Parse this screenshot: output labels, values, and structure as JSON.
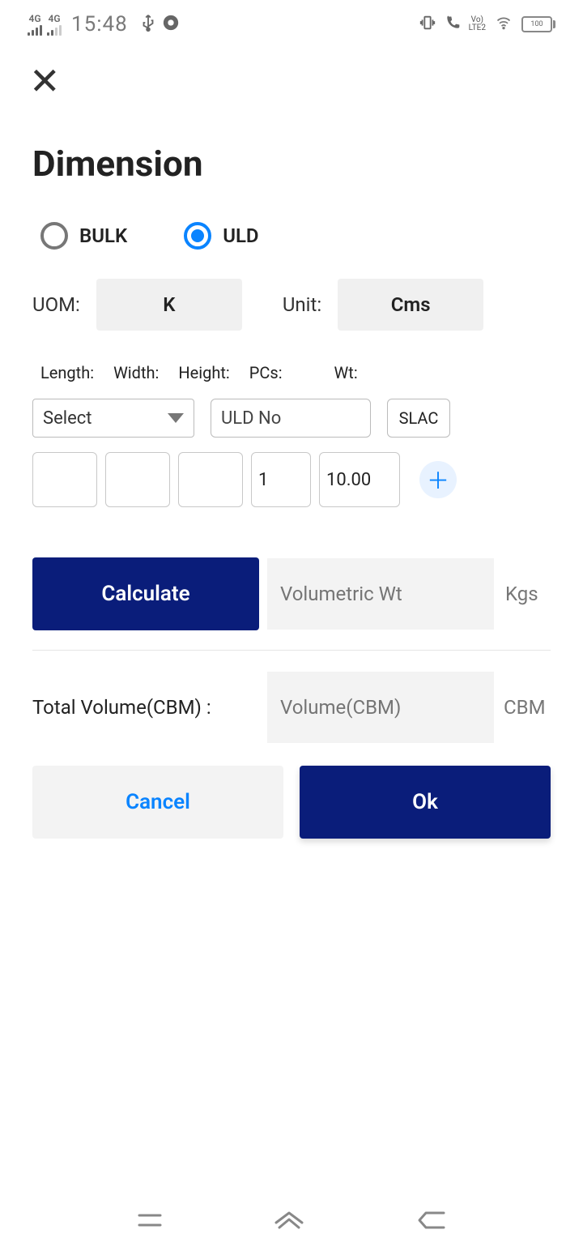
{
  "status_bar": {
    "time": "15:48",
    "battery": "100"
  },
  "close_icon": "✕",
  "title": "Dimension",
  "radios": {
    "bulk": "BULK",
    "uld": "ULD"
  },
  "uom": {
    "label": "UOM:",
    "value": "K",
    "unit_label": "Unit:",
    "unit_value": "Cms"
  },
  "headers": {
    "length": "Length:",
    "width": "Width:",
    "height": "Height:",
    "pcs": "PCs:",
    "wt": "Wt:"
  },
  "select": {
    "placeholder": "Select",
    "uldno_label": "ULD No",
    "slac": "SLAC"
  },
  "inputs": {
    "length": "",
    "width": "",
    "height": "",
    "pcs": "1",
    "wt": "10.00"
  },
  "calc": {
    "button": "Calculate",
    "volwt_ph": "Volumetric Wt",
    "kgs": "Kgs"
  },
  "volume": {
    "label": "Total Volume(CBM) :",
    "ph": "Volume(CBM)",
    "unit": "CBM"
  },
  "actions": {
    "cancel": "Cancel",
    "ok": "Ok"
  }
}
